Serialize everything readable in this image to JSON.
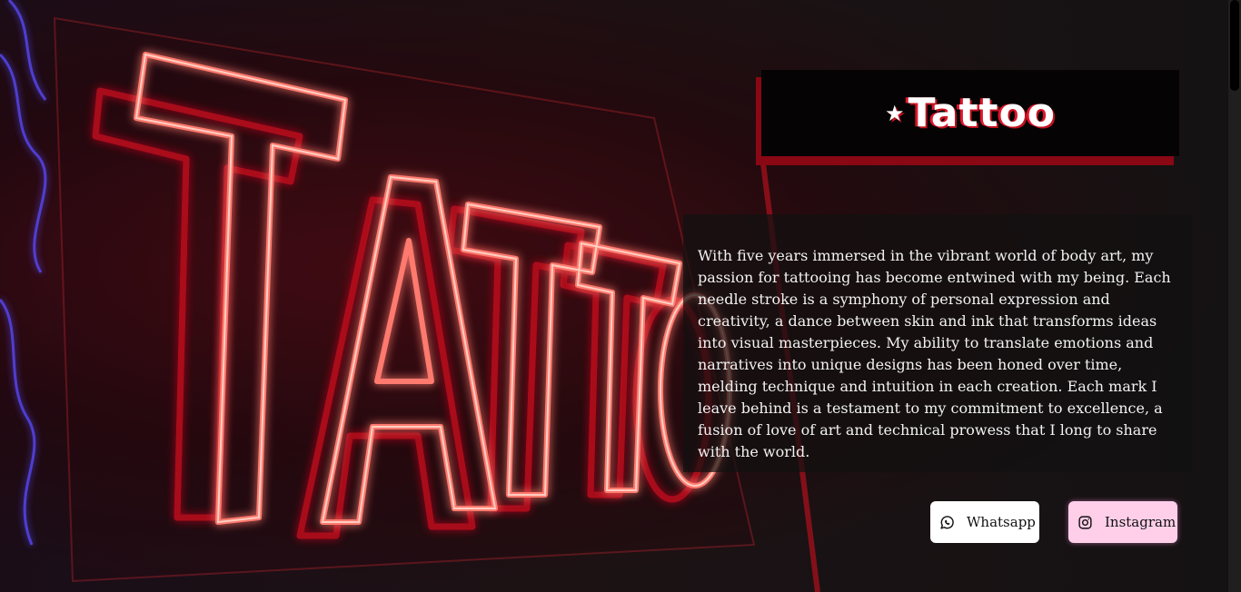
{
  "header": {
    "star_icon": "★",
    "title": "Tattoo"
  },
  "hero": {
    "neon_sign_text": "TATTOO"
  },
  "about": {
    "text": "With five years immersed in the vibrant world of body art, my passion for tattooing has become entwined with my being. Each needle stroke is a symphony of personal expression and creativity, a dance between skin and ink that transforms ideas into visual masterpieces. My ability to translate emotions and narratives into unique designs has been honed over time, melding technique and intuition in each creation. Each mark I leave behind is a testament to my commitment to excellence, a fusion of love of art and technical prowess that I long to share with the world."
  },
  "social": {
    "whatsapp_label": "Whatsapp",
    "instagram_label": "Instagram",
    "whatsapp_icon": "whatsapp-icon",
    "instagram_icon": "instagram-icon"
  },
  "colors": {
    "accent": "#c1121f",
    "neon": "#ff2a3a",
    "instagram_bg": "#ffcfe9"
  }
}
